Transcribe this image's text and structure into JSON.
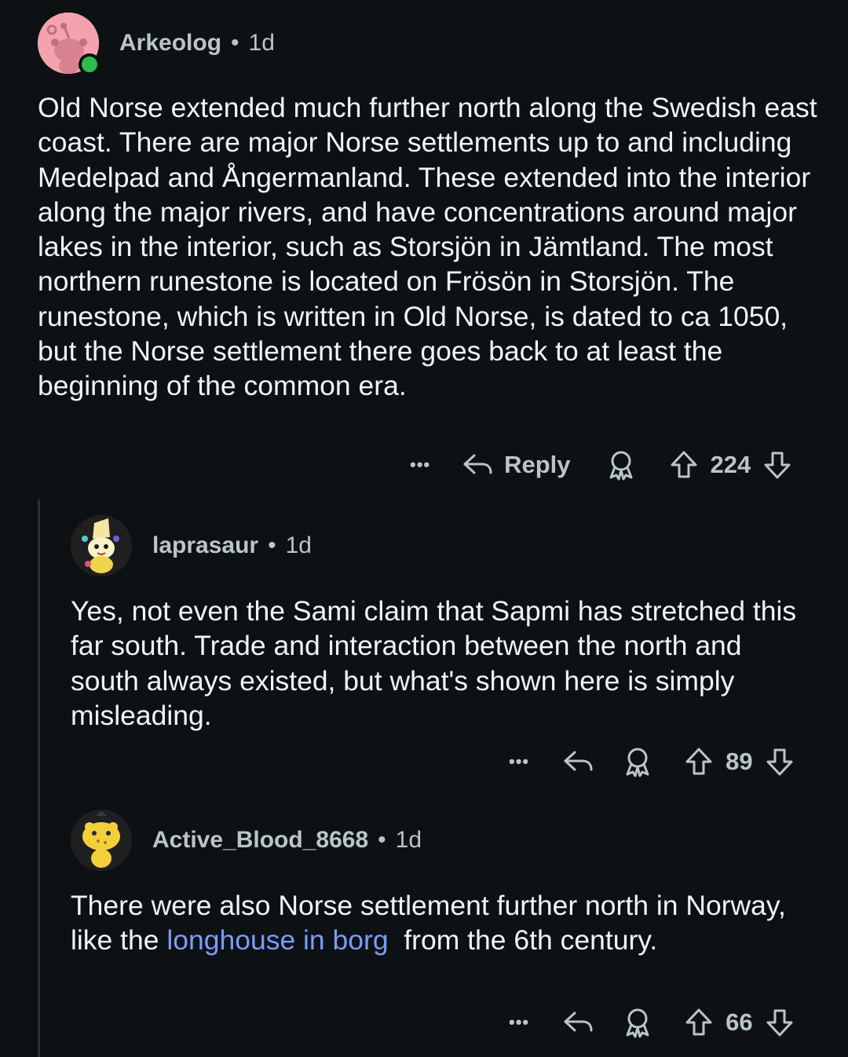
{
  "comments": [
    {
      "username": "Arkeolog",
      "time": "1d",
      "separator": "•",
      "body": "Old Norse extended much further north along the Swedish east coast. There are major Norse settlements up to and including Medelpad and Ångermanland. These extended into the interior along the major rivers, and have concentrations around major lakes in the interior, such as Storsjön in Jämtland. The most northern runestone is located on Frösön in Storsjön. The runestone, which is written in Old Norse, is dated to ca 1050, but the Norse settlement there goes back to at least the beginning of the common era.",
      "reply_label": "Reply",
      "votes": "224",
      "more_label": "•••"
    },
    {
      "username": "laprasaur",
      "time": "1d",
      "separator": "•",
      "body": "Yes, not even the Sami claim that Sapmi has stretched this far south. Trade and interaction between the north and south always existed, but what's shown here is simply misleading.",
      "votes": "89",
      "more_label": "•••"
    },
    {
      "username": "Active_Blood_8668",
      "time": "1d",
      "separator": "•",
      "body_before": "There were also Norse settlement further north in Norway, like the ",
      "body_link": "longhouse in borg",
      "body_after": "  from the 6th century.",
      "votes": "66",
      "more_label": "•••"
    }
  ],
  "icons": [
    "more-icon",
    "reply-icon",
    "award-icon",
    "upvote-icon",
    "downvote-icon"
  ],
  "colors": {
    "background": "#0e1113",
    "text": "#f2f4f5",
    "meta": "#b8c5c9",
    "link": "#7a9cff",
    "online": "#2dbd4e"
  }
}
